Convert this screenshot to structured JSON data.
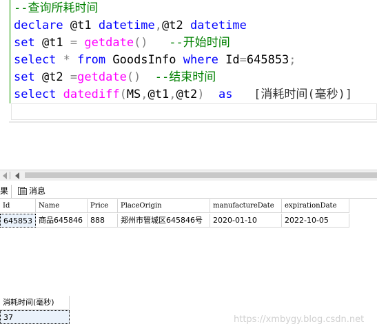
{
  "editor": {
    "lines": [
      {
        "parts": [
          {
            "t": "--查询所耗时间",
            "c": "cmt"
          }
        ]
      },
      {
        "parts": [
          {
            "t": "declare",
            "c": "kw"
          },
          {
            "t": " @t1 ",
            "c": "id"
          },
          {
            "t": "datetime",
            "c": "kw"
          },
          {
            "t": ",",
            "c": "op"
          },
          {
            "t": "@t2 ",
            "c": "id"
          },
          {
            "t": "datetime",
            "c": "kw"
          }
        ]
      },
      {
        "parts": [
          {
            "t": "set",
            "c": "kw"
          },
          {
            "t": " @t1 ",
            "c": "id"
          },
          {
            "t": "=",
            "c": "op"
          },
          {
            "t": " ",
            "c": "id"
          },
          {
            "t": "getdate",
            "c": "fn"
          },
          {
            "t": "()",
            "c": "op"
          },
          {
            "t": "   ",
            "c": "id"
          },
          {
            "t": "--开始时间",
            "c": "cmt"
          }
        ]
      },
      {
        "parts": [
          {
            "t": "select",
            "c": "kw"
          },
          {
            "t": " ",
            "c": "id"
          },
          {
            "t": "*",
            "c": "op"
          },
          {
            "t": " ",
            "c": "id"
          },
          {
            "t": "from",
            "c": "kw"
          },
          {
            "t": " GoodsInfo ",
            "c": "id"
          },
          {
            "t": "where",
            "c": "kw"
          },
          {
            "t": " Id",
            "c": "id"
          },
          {
            "t": "=",
            "c": "op"
          },
          {
            "t": "645853",
            "c": "num"
          },
          {
            "t": ";",
            "c": "op"
          }
        ]
      },
      {
        "parts": [
          {
            "t": "set",
            "c": "kw"
          },
          {
            "t": " @t2 ",
            "c": "id"
          },
          {
            "t": "=",
            "c": "op"
          },
          {
            "t": "getdate",
            "c": "fn"
          },
          {
            "t": "()",
            "c": "op"
          },
          {
            "t": "  ",
            "c": "id"
          },
          {
            "t": "--结束时间",
            "c": "cmt"
          }
        ]
      },
      {
        "parts": [
          {
            "t": "select",
            "c": "kw"
          },
          {
            "t": " ",
            "c": "id"
          },
          {
            "t": "datediff",
            "c": "fn"
          },
          {
            "t": "(",
            "c": "op"
          },
          {
            "t": "MS",
            "c": "id"
          },
          {
            "t": ",",
            "c": "op"
          },
          {
            "t": "@t1",
            "c": "id"
          },
          {
            "t": ",",
            "c": "op"
          },
          {
            "t": "@t2",
            "c": "id"
          },
          {
            "t": ")",
            "c": "op"
          },
          {
            "t": "  ",
            "c": "id"
          },
          {
            "t": "as",
            "c": "kw"
          },
          {
            "t": "   ",
            "c": "id"
          },
          {
            "t": "[消耗时间(毫秒)]",
            "c": "lit"
          }
        ]
      },
      {
        "parts": []
      }
    ]
  },
  "tabs": {
    "results_label": "果",
    "messages_label": "消息"
  },
  "grid1": {
    "columns": [
      "Id",
      "Name",
      "Price",
      "PlaceOrigin",
      "manufactureDate",
      "expirationDate"
    ],
    "rows": [
      [
        "645853",
        "商品645846",
        "888",
        "郑州市管城区645846号",
        "2020-01-10",
        "2022-10-05"
      ]
    ]
  },
  "grid2": {
    "columns": [
      "消耗时间(毫秒)"
    ],
    "rows": [
      [
        "37"
      ]
    ]
  },
  "watermark": "https://xmbygy.blog.csdn.net",
  "colors": {
    "keyword": "#0000ff",
    "function": "#ff00ff",
    "comment": "#008000",
    "operator": "#808080"
  }
}
